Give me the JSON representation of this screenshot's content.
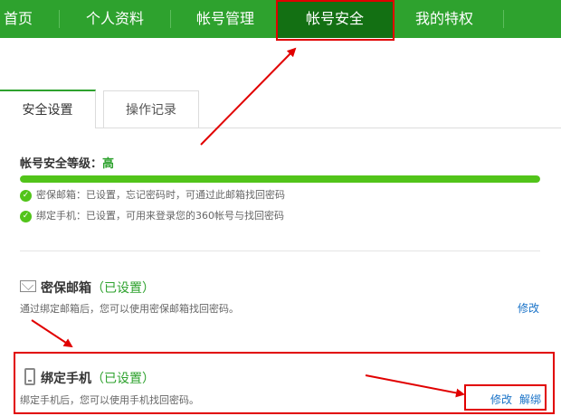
{
  "nav": {
    "items": [
      {
        "label": "首页"
      },
      {
        "label": "个人资料"
      },
      {
        "label": "帐号管理"
      },
      {
        "label": "帐号安全"
      },
      {
        "label": "我的特权"
      }
    ],
    "active_index": 3
  },
  "tabs": [
    {
      "label": "安全设置"
    },
    {
      "label": "操作记录"
    }
  ],
  "security": {
    "level_label": "帐号安全等级：",
    "level_value": "高",
    "progress_percent": 100,
    "checks": [
      {
        "text": "密保邮箱：已设置，忘记密码时，可通过此邮箱找回密码"
      },
      {
        "text": "绑定手机：已设置，可用来登录您的360帐号与找回密码"
      }
    ]
  },
  "email_section": {
    "title": "密保邮箱",
    "status": "（已设置）",
    "desc": "通过绑定邮箱后，您可以使用密保邮箱找回密码。",
    "modify": "修改"
  },
  "phone_section": {
    "title": "绑定手机",
    "status": "（已设置）",
    "desc": "绑定手机后，您可以使用手机找回密码。",
    "modify": "修改",
    "unbind": "解绑"
  },
  "colors": {
    "nav_bg": "#2ea22e",
    "nav_active": "#137013",
    "accent_green": "#52c41a",
    "link_blue": "#1a73c8",
    "annotation_red": "#e10000"
  }
}
